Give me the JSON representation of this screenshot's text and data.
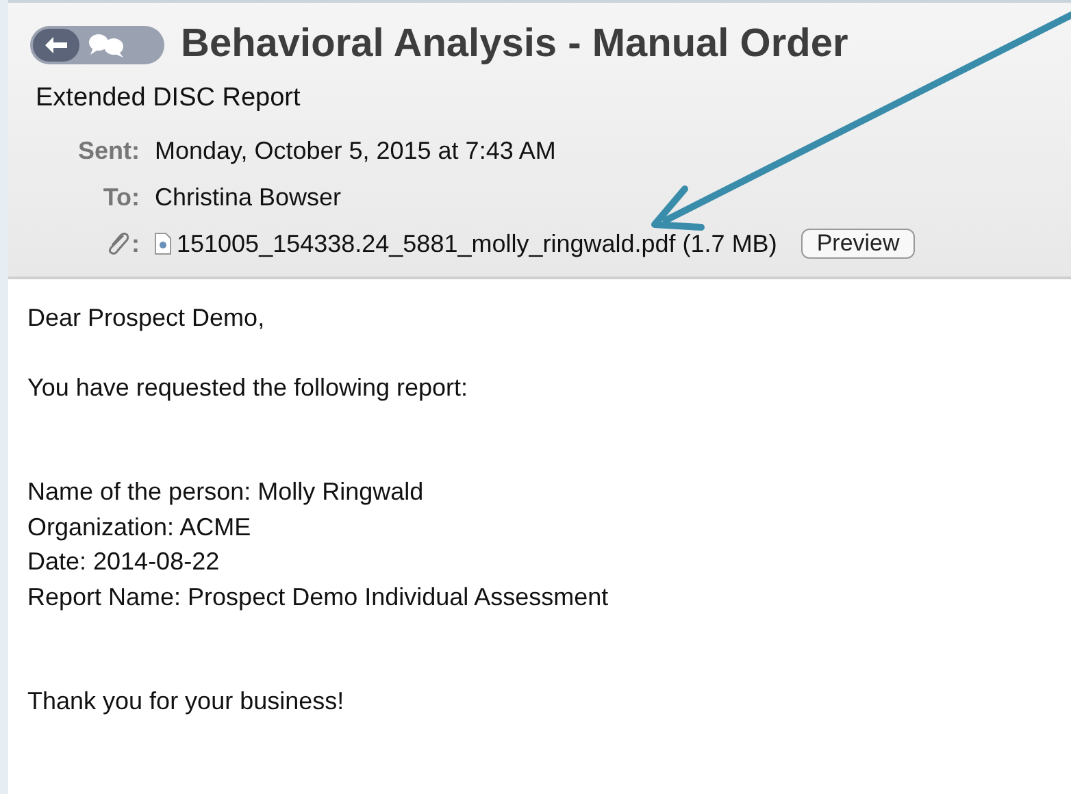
{
  "header": {
    "title": "Behavioral Analysis - Manual Order",
    "subtitle": "Extended DISC Report",
    "fields": [
      {
        "label": "Sent:",
        "value": "Monday, October 5, 2015 at 7:43 AM"
      },
      {
        "label": "To:",
        "value": "Christina Bowser"
      }
    ],
    "attachment": {
      "label": ":",
      "file": "151005_154338.24_5881_molly_ringwald.pdf (1.7 MB)",
      "button": "Preview"
    }
  },
  "body": {
    "paragraphs": [
      [
        "Dear Prospect Demo,"
      ],
      [
        "You have requested the following report:"
      ],
      [
        "Name of the person: Molly Ringwald",
        "Organization: ACME",
        "Date: 2014-08-22",
        "Report Name: Prospect Demo Individual Assessment"
      ],
      [
        "Thank you for your business!"
      ]
    ]
  }
}
